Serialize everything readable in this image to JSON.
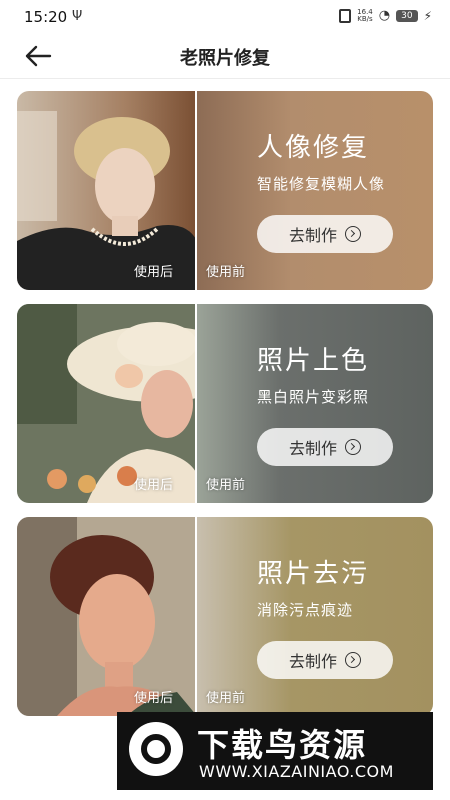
{
  "status_bar": {
    "time": "15:20",
    "usb_glyph": "Ψ",
    "net_speed_value": "16.4",
    "net_speed_unit": "KB/s",
    "wifi_glyph": "◔",
    "battery": "30",
    "charging_glyph": "⚡"
  },
  "header": {
    "title": "老照片修复"
  },
  "cards": [
    {
      "title": "人像修复",
      "subtitle": "智能修复模糊人像",
      "button": "去制作",
      "label_after": "使用后",
      "label_before": "使用前",
      "color": "#b28d6d"
    },
    {
      "title": "照片上色",
      "subtitle": "黑白照片变彩照",
      "button": "去制作",
      "label_after": "使用后",
      "label_before": "使用前",
      "color": "#6b6f6c"
    },
    {
      "title": "照片去污",
      "subtitle": "消除污点痕迹",
      "button": "去制作",
      "label_after": "使用后",
      "label_before": "使用前",
      "color": "#a69665"
    }
  ],
  "watermark": {
    "title": "下载鸟资源",
    "url": "WWW.XIAZAINIAO.COM"
  }
}
